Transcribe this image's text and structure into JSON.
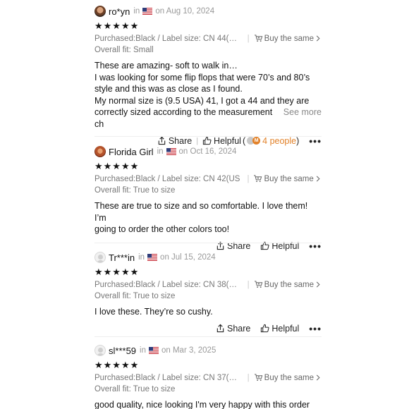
{
  "reviews": [
    {
      "username": "ro*yn",
      "in_text": "in",
      "date": "on Aug 10, 2024",
      "stars": "★★★★★",
      "purchased": "Purchased:Black / Label size: CN 44(US 1…",
      "buy_same": "Buy the same",
      "fit": "Overall fit: Small",
      "body_lines": [
        "These are amazing- soft to walk in…",
        "I was looking for some flip flops that were 70’s and 80’s",
        "style and this was as close as I found.",
        "My normal size is (9.5 USA) 41, I got a 44 and they are"
      ],
      "body_last_line": "correctly sized according to the measurement ch",
      "see_more": "See more",
      "share": "Share",
      "helpful": "Helpful",
      "helpful_open": "(",
      "helpful_count": "4 people",
      "helpful_close": ")"
    },
    {
      "username": "Florida Girl",
      "in_text": "in",
      "date": "on Oct 16, 2024",
      "stars": "★★★★★",
      "purchased": "Purchased:Black / Label size: CN 42(US",
      "buy_same": "Buy the same",
      "fit": "Overall fit: True to size",
      "body_lines": [
        "These are true to size and so comfortable. I love them! I’m",
        "going to order the other colors too!"
      ],
      "share": "Share",
      "helpful": "Helpful"
    },
    {
      "username": "Tr***in",
      "in_text": "in",
      "date": "on Jul 15, 2024",
      "stars": "★★★★★",
      "purchased": "Purchased:Black / Label size: CN 38(US…",
      "buy_same": "Buy the same",
      "fit": "Overall fit: True to size",
      "body_lines": [
        "I love these. They’re so cushy."
      ],
      "share": "Share",
      "helpful": "Helpful"
    },
    {
      "username": "sl***59",
      "in_text": "in",
      "date": "on Mar 3, 2025",
      "stars": "★★★★★",
      "purchased": "Purchased:Black / Label size: CN 37(US 6)",
      "buy_same": "Buy the same",
      "fit": "Overall fit: True to size",
      "body_lines": [
        "good quality, nice looking I'm very happy with this order"
      ]
    }
  ],
  "more_label": "•••",
  "colors": {
    "accent": "#e2822a",
    "muted": "#999999",
    "text": "#111111"
  }
}
